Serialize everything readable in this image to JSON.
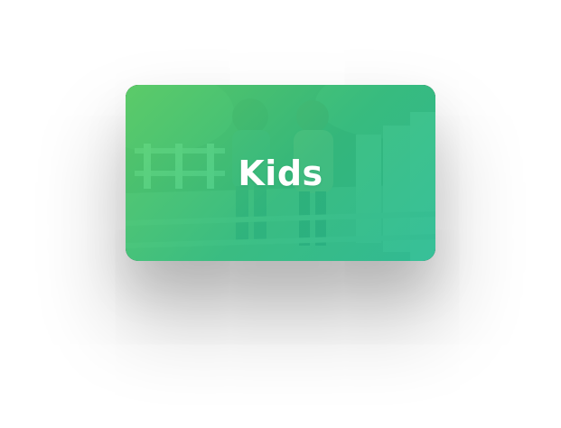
{
  "category_card": {
    "title": "Kids",
    "image_subject": "two-children-walking-photo",
    "overlay_gradient": [
      "#5fde6e",
      "#32d48c",
      "#28cea0"
    ],
    "text_color": "#ffffff"
  }
}
